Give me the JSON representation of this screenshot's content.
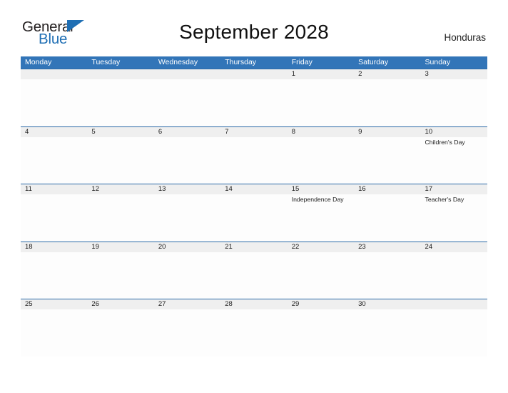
{
  "branding": {
    "logo_primary": "General",
    "logo_secondary": "Blue",
    "logo_icon": "triangle-flag-icon",
    "accent_color": "#1f6fb4"
  },
  "header": {
    "title": "September 2028",
    "month": "September",
    "year": "2028",
    "country": "Honduras"
  },
  "theme": {
    "header_blue": "#3275b8",
    "row_divider_blue": "#2c6aa8",
    "date_band_gray": "#efefef",
    "cell_white": "#fdfdfd"
  },
  "calendar": {
    "weekdays": [
      "Monday",
      "Tuesday",
      "Wednesday",
      "Thursday",
      "Friday",
      "Saturday",
      "Sunday"
    ],
    "weeks": [
      {
        "days": [
          {
            "date": "",
            "event": ""
          },
          {
            "date": "",
            "event": ""
          },
          {
            "date": "",
            "event": ""
          },
          {
            "date": "",
            "event": ""
          },
          {
            "date": "1",
            "event": ""
          },
          {
            "date": "2",
            "event": ""
          },
          {
            "date": "3",
            "event": ""
          }
        ]
      },
      {
        "days": [
          {
            "date": "4",
            "event": ""
          },
          {
            "date": "5",
            "event": ""
          },
          {
            "date": "6",
            "event": ""
          },
          {
            "date": "7",
            "event": ""
          },
          {
            "date": "8",
            "event": ""
          },
          {
            "date": "9",
            "event": ""
          },
          {
            "date": "10",
            "event": "Children's Day"
          }
        ]
      },
      {
        "days": [
          {
            "date": "11",
            "event": ""
          },
          {
            "date": "12",
            "event": ""
          },
          {
            "date": "13",
            "event": ""
          },
          {
            "date": "14",
            "event": ""
          },
          {
            "date": "15",
            "event": "Independence Day"
          },
          {
            "date": "16",
            "event": ""
          },
          {
            "date": "17",
            "event": "Teacher's Day"
          }
        ]
      },
      {
        "days": [
          {
            "date": "18",
            "event": ""
          },
          {
            "date": "19",
            "event": ""
          },
          {
            "date": "20",
            "event": ""
          },
          {
            "date": "21",
            "event": ""
          },
          {
            "date": "22",
            "event": ""
          },
          {
            "date": "23",
            "event": ""
          },
          {
            "date": "24",
            "event": ""
          }
        ]
      },
      {
        "days": [
          {
            "date": "25",
            "event": ""
          },
          {
            "date": "26",
            "event": ""
          },
          {
            "date": "27",
            "event": ""
          },
          {
            "date": "28",
            "event": ""
          },
          {
            "date": "29",
            "event": ""
          },
          {
            "date": "30",
            "event": ""
          },
          {
            "date": "",
            "event": ""
          }
        ]
      }
    ]
  }
}
